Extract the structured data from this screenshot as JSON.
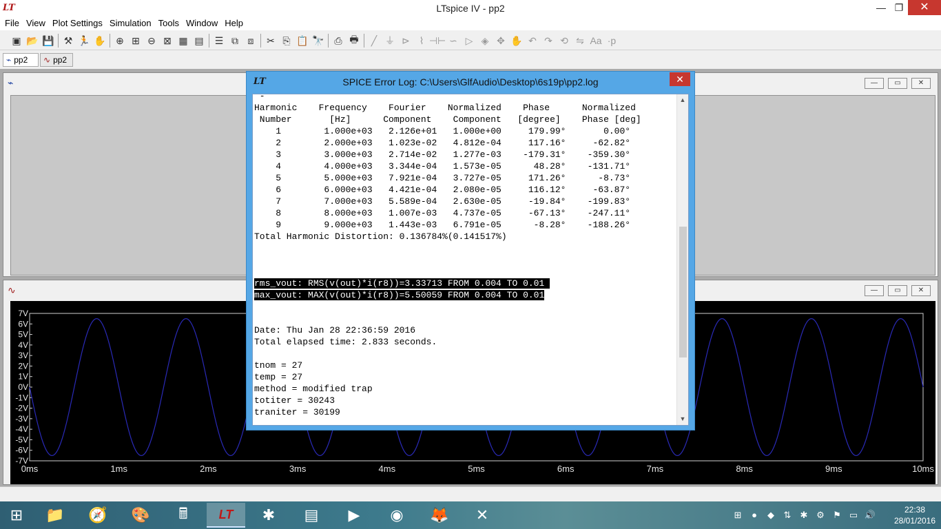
{
  "window": {
    "title": "LTspice IV - pp2",
    "min_glyph": "—",
    "max_glyph": "❐",
    "close_glyph": "✕"
  },
  "menu": [
    "File",
    "View",
    "Plot Settings",
    "Simulation",
    "Tools",
    "Window",
    "Help"
  ],
  "toolbar_icons": [
    "new-schematic-icon",
    "open-icon",
    "save-icon",
    "control-panel-icon",
    "run-icon",
    "pause-icon",
    "zoom-in-icon",
    "zoom-area-icon",
    "zoom-out-icon",
    "zoom-fit-icon",
    "grid-icon",
    "autoscale-icon",
    "tile-horizontal-icon",
    "cascade-icon",
    "tile-vertical-icon",
    "cut-icon",
    "copy-icon",
    "paste-icon",
    "find-icon",
    "print-setup-icon",
    "print-icon",
    "wire-icon",
    "ground-icon",
    "label-icon",
    "resistor-icon",
    "capacitor-icon",
    "inductor-icon",
    "diode-icon",
    "component-icon",
    "move-icon",
    "drag-icon",
    "undo-icon",
    "redo-icon",
    "rotate-icon",
    "mirror-icon",
    "text-icon",
    "spice-directive-icon"
  ],
  "tabs": [
    {
      "label": "pp2",
      "icon": "schematic-icon"
    },
    {
      "label": "pp2",
      "icon": "waveform-icon"
    }
  ],
  "plot": {
    "y_ticks": [
      "7V",
      "6V",
      "5V",
      "4V",
      "3V",
      "2V",
      "1V",
      "0V",
      "-1V",
      "-2V",
      "-3V",
      "-4V",
      "-5V",
      "-6V",
      "-7V"
    ],
    "x_ticks": [
      "0ms",
      "1ms",
      "2ms",
      "3ms",
      "4ms",
      "5ms",
      "6ms",
      "7ms",
      "8ms",
      "9ms",
      "10ms"
    ],
    "trace_color": "#2a2ab8"
  },
  "chart_data": {
    "type": "line",
    "x": [
      0,
      0.25,
      0.5,
      0.75,
      1.0,
      1.25,
      1.5,
      1.75,
      2.0,
      2.25,
      2.5,
      2.75,
      3.0,
      3.25,
      3.5,
      3.75,
      4.0,
      4.25,
      4.5,
      4.75,
      5.0,
      5.25,
      5.5,
      5.75,
      6.0,
      6.25,
      6.5,
      6.75,
      7.0,
      7.25,
      7.5,
      7.75,
      8.0,
      8.25,
      8.5,
      8.75,
      9.0,
      9.25,
      9.5,
      9.75,
      10.0
    ],
    "series": [
      {
        "values": [
          0,
          -6.5,
          0,
          6.5,
          0,
          -6.5,
          0,
          6.5,
          0,
          -6.5,
          0,
          6.5,
          0,
          -6.5,
          0,
          6.5,
          0,
          -6.5,
          0,
          6.5,
          0,
          -6.5,
          0,
          6.5,
          0,
          -6.5,
          0,
          6.5,
          0,
          -6.5,
          0,
          6.5,
          0,
          -6.5,
          0,
          6.5,
          0,
          -6.5,
          0,
          6.5,
          0
        ]
      }
    ],
    "xlim": [
      0,
      10
    ],
    "ylim": [
      -7,
      7
    ],
    "xlabel": "",
    "ylabel": ""
  },
  "dialog": {
    "title": "SPICE Error Log: C:\\Users\\GlfAudio\\Desktop\\6s19p\\pp2.log",
    "close_glyph": "✕",
    "lines": [
      " -",
      "Harmonic    Frequency    Fourier    Normalized    Phase      Normalized",
      " Number       [Hz]      Component    Component   [degree]    Phase [deg]",
      "    1        1.000e+03   2.126e+01   1.000e+00     179.99°       0.00°",
      "    2        2.000e+03   1.023e-02   4.812e-04     117.16°     -62.82°",
      "    3        3.000e+03   2.714e-02   1.277e-03    -179.31°    -359.30°",
      "    4        4.000e+03   3.344e-04   1.573e-05      48.28°    -131.71°",
      "    5        5.000e+03   7.921e-04   3.727e-05     171.26°      -8.73°",
      "    6        6.000e+03   4.421e-04   2.080e-05     116.12°     -63.87°",
      "    7        7.000e+03   5.589e-04   2.630e-05     -19.84°    -199.83°",
      "    8        8.000e+03   1.007e-03   4.737e-05     -67.13°    -247.11°",
      "    9        9.000e+03   1.443e-03   6.791e-05      -8.28°    -188.26°",
      "Total Harmonic Distortion: 0.136784%(0.141517%)",
      "",
      "",
      "",
      "rms_vout: RMS(v(out)*i(r8))=3.33713 FROM 0.004 TO 0.01 ",
      "max_vout: MAX(v(out)*i(r8))=5.50059 FROM 0.004 TO 0.01",
      "",
      "",
      "Date: Thu Jan 28 22:36:59 2016",
      "Total elapsed time: 2.833 seconds.",
      "",
      "tnom = 27",
      "temp = 27",
      "method = modified trap",
      "totiter = 30243",
      "traniter = 30199"
    ],
    "highlighted_lines": [
      16,
      17
    ]
  },
  "taskbar": {
    "apps": [
      "start-icon",
      "file-explorer-icon",
      "safari-icon",
      "paint-icon",
      "calculator-icon",
      "ltspice-icon",
      "ltspice-doc-icon",
      "archive-icon",
      "video-icon",
      "chrome-icon",
      "firefox-icon",
      "xilinx-icon"
    ],
    "time": "22:38",
    "date": "28/01/2016"
  }
}
